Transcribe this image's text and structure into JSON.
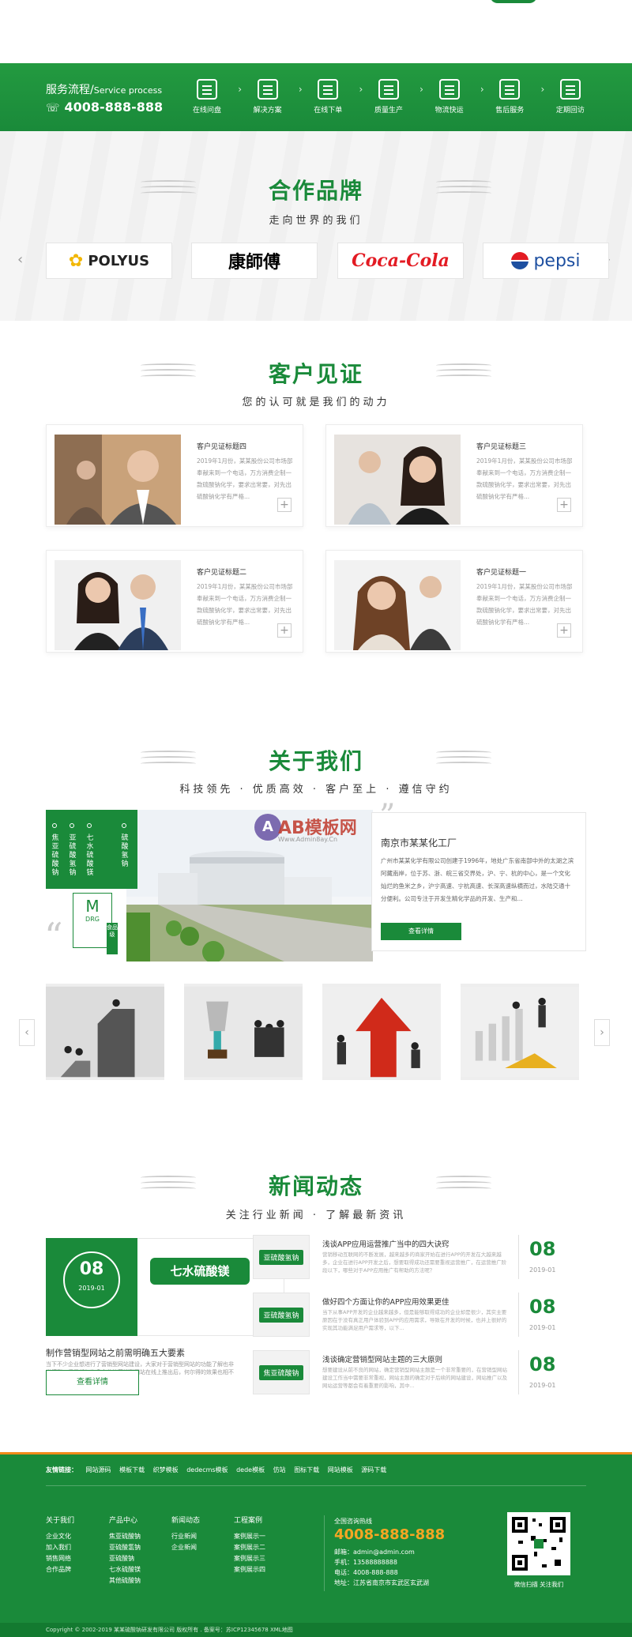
{
  "service": {
    "title": "服务流程/",
    "title_en": "Service process",
    "phone": "4008-888-888",
    "steps": [
      {
        "label": "在线问盘",
        "icon": "chart-icon"
      },
      {
        "label": "解决方案",
        "icon": "document-icon"
      },
      {
        "label": "在线下单",
        "icon": "calendar-icon"
      },
      {
        "label": "质量生产",
        "icon": "factory-icon"
      },
      {
        "label": "物流快运",
        "icon": "truck-icon"
      },
      {
        "label": "售后服务",
        "icon": "headset-icon"
      },
      {
        "label": "定期回访",
        "icon": "chat-icon"
      }
    ]
  },
  "brands": {
    "title": "合作品牌",
    "subtitle": "走向世界的我们",
    "items": [
      "POLYUS",
      "康師傅",
      "Coca-Cola",
      "pepsi"
    ]
  },
  "testimonials": {
    "title": "客户见证",
    "subtitle": "您的认可就是我们的动力",
    "items": [
      {
        "title": "客户见证标题四",
        "text": "2019年1月份，某某股份公司市场部奉献来到一个电话，万方消费企制一款硫酸钠化学，要求出常要，对先出硫酸钠化学有严格..."
      },
      {
        "title": "客户见证标题三",
        "text": "2019年1月份，某某股份公司市场部奉献来到一个电话，万方消费企制一款硫酸钠化学，要求出常要，对先出硫酸钠化学有严格..."
      },
      {
        "title": "客户见证标题二",
        "text": "2019年1月份，某某股份公司市场部奉献来到一个电话，万方消费企制一款硫酸钠化学，要求出常要，对先出硫酸钠化学有严格..."
      },
      {
        "title": "客户见证标题一",
        "text": "2019年1月份，某某股份公司市场部奉献来到一个电话，万方消费企制一款硫酸钠化学，要求出常要，对先出硫酸钠化学有严格..."
      }
    ]
  },
  "about": {
    "title": "关于我们",
    "subtitle": "科技领先 · 优质高效 · 客户至上 · 遵信守约",
    "panel_labels": [
      "焦亚硫酸钠",
      "亚硫酸氢钠",
      "七水硫酸镁",
      "硫酸氢钠"
    ],
    "logo_text": "M",
    "logo_sub": "DRG",
    "tag": "食品级",
    "watermark": "AB模板网",
    "watermark_url": "Www.Admin8ay.Cn",
    "company_name": "南京市某某化工厂",
    "description": "广州市某某化学有限公司创建于1996年，地处广东省南部中外的太湖之滨阿藏南岸，位于苏、浙、皖三省交界处，沪、宁、杭的中心，是一个文化灿烂的鱼米之乡，沪宁高速、宁杭高速、长深高速纵横而过，水陆交通十分便利。公司专注于开发生精化学品的开发、生产和...",
    "button": "查看详情"
  },
  "news": {
    "title": "新闻动态",
    "subtitle": "关注行业新闻 · 了解最新资讯",
    "feature": {
      "day": "08",
      "month": "2019-01",
      "banner": "七水硫酸镁",
      "title": "制作营销型网站之前需明确五大要素",
      "text": "当下不少企业想进行了营销型网站建设，大家对于营销型网站的功能了解也非常模型，但是任何许多企业的营销型网站在线上推出后，何尔得的效果也相不理...",
      "button": "查看详情"
    },
    "items": [
      {
        "thumb": "亚硫酸氢钠",
        "title": "浅谈APP应用运营推广当中的四大诀窍",
        "text": "营销移动互联网的不断发展，越来越多的商家开始在进行APP的开发在大越来越多，企业在进行APP开发之后，想要取得成功还需要重视运营推广，在运营推广阶段以下，哪些对于APP应用推广有帮助的方法呢？",
        "day": "08",
        "month": "2019-01"
      },
      {
        "thumb": "亚硫酸氢钠",
        "title": "做好四个方面让你的APP应用效果更佳",
        "text": "当下从事APP开发的企业越来越多，但是能够取得成功的企业却是很少，其实主要原因在于没有真正用户体验到APP的应用需求，导致在开发的时候，也并上很好的实现其功能满足用户需求等，以下...",
        "day": "08",
        "month": "2019-01"
      },
      {
        "thumb": "焦亚硫酸钠",
        "title": "浅谈确定营销型网站主题的三大原则",
        "text": "想要建设从前不良的网站，确定营销型网站主题是一个非常重要的，在营销型网站建设工作当中需要非常重视，网站主题的确定对于后续的网站建设，网站推广以及网站运营等都会有着重要的影响，其中...",
        "day": "08",
        "month": "2019-01"
      }
    ]
  },
  "footer": {
    "links_label": "友情链接：",
    "links": [
      "网站源码",
      "模板下载",
      "织梦模板",
      "dedecms模板",
      "dede模板",
      "仿站",
      "图标下载",
      "网站模板",
      "源码下载"
    ],
    "columns": [
      {
        "title": "关于我们",
        "items": [
          "企业文化",
          "加入我们",
          "销售网络",
          "合作品牌"
        ]
      },
      {
        "title": "产品中心",
        "items": [
          "焦亚硫酸钠",
          "亚硫酸氢钠",
          "亚硫酸钠",
          "七水硫酸镁",
          "其他硫酸钠"
        ]
      },
      {
        "title": "新闻动态",
        "items": [
          "行业新闻",
          "企业新闻"
        ]
      },
      {
        "title": "工程案例",
        "items": [
          "案例展示一",
          "案例展示二",
          "案例展示三",
          "案例展示四"
        ]
      }
    ],
    "hotline_label": "全国咨询热线",
    "hotline": "4008-888-888",
    "contacts": [
      "邮箱：admin@admin.com",
      "手机：13588888888",
      "电话：4008-888-888",
      "地址：江苏省南京市玄武区玄武湖"
    ],
    "qr_label": "微信扫描 关注我们",
    "copyright": "Copyright © 2002-2019 某某硫酸钠研发有限公司 版权所有 . 备案号：苏ICP12345678 XML地图"
  },
  "colors": {
    "brand_green": "#1a8a3a",
    "accent_orange": "#f08a1a"
  }
}
